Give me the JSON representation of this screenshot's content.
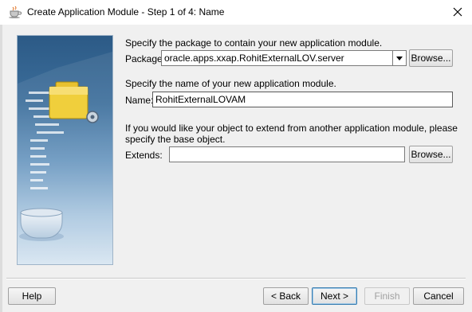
{
  "window": {
    "title": "Create Application Module - Step 1 of 4: Name",
    "app_icon": "coffee-cup-icon",
    "close_icon": "close-icon"
  },
  "package_section": {
    "instruction": "Specify the package to contain your new application module.",
    "label": "Package:",
    "value": "oracle.apps.xxap.RohitExternalLOV.server",
    "browse_label": "Browse..."
  },
  "name_section": {
    "instruction": "Specify the name of your new application module.",
    "label": "Name:",
    "value": "RohitExternalLOVAM"
  },
  "extends_section": {
    "instruction_line1": "If you would like your object to extend from another application module, please",
    "instruction_line2": "specify the base object.",
    "label": "Extends:",
    "value": "",
    "browse_label": "Browse..."
  },
  "buttons": {
    "help": "Help",
    "back": "< Back",
    "next": "Next >",
    "finish": "Finish",
    "cancel": "Cancel"
  },
  "colors": {
    "accent": "#3c7fb1",
    "panel_top": "#2c5a86",
    "panel_bottom": "#d7e5f1"
  }
}
